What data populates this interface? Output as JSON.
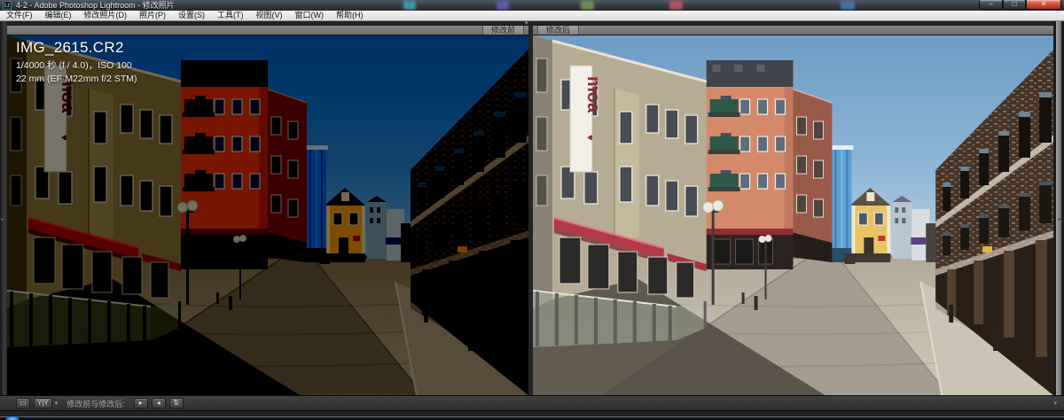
{
  "window": {
    "title": "4-2 - Adobe Photoshop Lightroom - 修改照片",
    "app_icon_label": "Lr"
  },
  "menubar": {
    "items": [
      "文件(F)",
      "编辑(E)",
      "修改照片(D)",
      "照片(P)",
      "设置(S)",
      "工具(T)",
      "视图(V)",
      "窗口(W)",
      "帮助(H)"
    ]
  },
  "view": {
    "before_label": "修改前",
    "after_label": "修改后"
  },
  "photo_overlay": {
    "filename": "IMG_2615.CR2",
    "settings_line": "1/4000 秒 (f / 4.0)，ISO 100",
    "lens_line": "22 mm (EF-M22mm f/2 STM)"
  },
  "photo_content": {
    "sign_text": "moa",
    "sign_mark": "♥"
  },
  "toolbar": {
    "compare_mode_label": "修改前与修改后:",
    "yy_button_label": "Y|Y"
  },
  "icons": {
    "minimize": "–",
    "maximize": "□",
    "close": "✕",
    "loupe_view": "▭",
    "dropdown_caret": "▾",
    "copy_right": "▸",
    "copy_left": "◂",
    "swap": "⇅",
    "divider_marker": "▾",
    "filmstrip_reveal": "▴",
    "left_panel_reveal": "▸",
    "right_panel_reveal": "◂"
  },
  "colors": {
    "awning_red": "#b23a46",
    "sky_blue": "#6e9cc6",
    "salmon_building": "#d58a6c",
    "yellow_house": "#e9c464",
    "brick_brown": "#463428",
    "header_bar_gray": "#7a7a7a",
    "menu_bg": "#ececec",
    "toolbar_bg": "#383838",
    "close_button_red": "#c23b2d"
  }
}
